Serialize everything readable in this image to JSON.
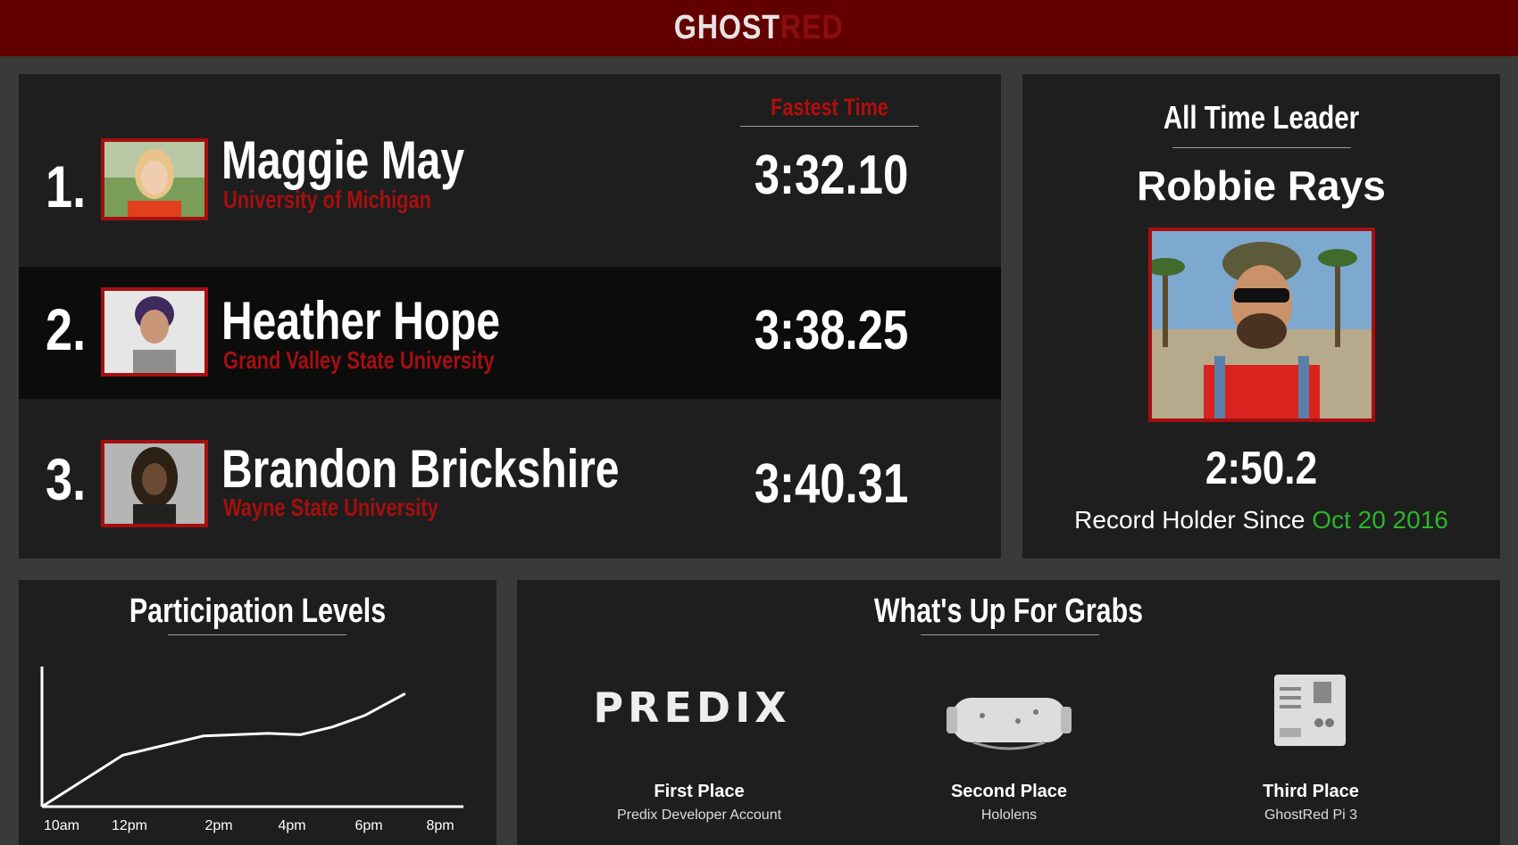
{
  "header": {
    "logo_part1": "GHOST",
    "logo_part2": "RED"
  },
  "leaderboard": {
    "fastest_time_label": "Fastest Time",
    "entries": [
      {
        "rank": "1.",
        "name": "Maggie May",
        "school": "University of Michigan",
        "time": "3:32.10"
      },
      {
        "rank": "2.",
        "name": "Heather Hope",
        "school": "Grand Valley State University",
        "time": "3:38.25"
      },
      {
        "rank": "3.",
        "name": "Brandon Brickshire",
        "school": "Wayne State University",
        "time": "3:40.31"
      }
    ]
  },
  "all_time_leader": {
    "title": "All Time Leader",
    "name": "Robbie Rays",
    "time": "2:50.2",
    "since_label": "Record Holder Since",
    "since_date": "Oct 20 2016"
  },
  "participation": {
    "title": "Participation Levels"
  },
  "chart_data": {
    "type": "line",
    "title": "Participation Levels",
    "x": [
      "10am",
      "12pm",
      "2pm",
      "4pm",
      "6pm",
      "8pm"
    ],
    "series": [
      {
        "values": [
          0,
          0.4,
          0.55,
          0.57,
          0.56,
          0.62,
          0.71,
          0.88
        ],
        "x_values": [
          0,
          1,
          2,
          2.8,
          3.2,
          3.6,
          4.0,
          4.5
        ]
      }
    ],
    "x_tick_positions": [
      0,
      1,
      2,
      3,
      4,
      5
    ],
    "xlim": [
      0,
      5
    ],
    "ylim": [
      0,
      1
    ],
    "grid": false
  },
  "grabs": {
    "title": "What's Up For Grabs",
    "prizes": [
      {
        "logo": "PREDIX",
        "place": "First Place",
        "item": "Predix Developer Account",
        "icon": "predix-logo-icon"
      },
      {
        "place": "Second Place",
        "item": "Hololens",
        "icon": "vr-headset-icon"
      },
      {
        "place": "Third Place",
        "item": "GhostRed Pi 3",
        "icon": "raspberry-pi-icon"
      }
    ]
  },
  "colors": {
    "accent_red": "#a50f0f",
    "header_bg": "#620000",
    "panel_bg": "#1e1e1e",
    "date_green": "#2bb52b"
  }
}
